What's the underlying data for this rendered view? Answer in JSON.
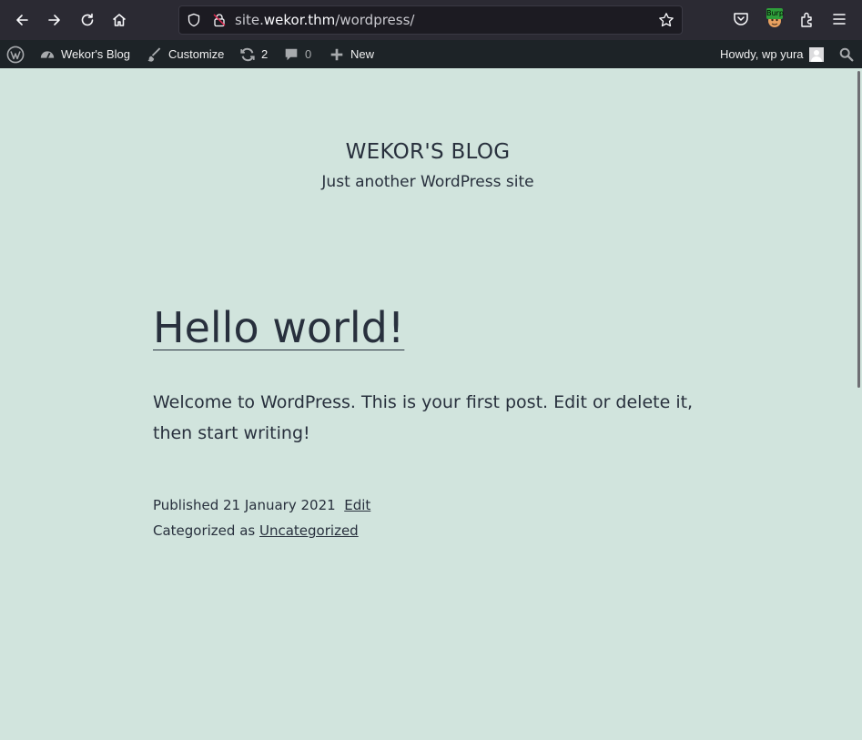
{
  "browser": {
    "url_prefix": "site.",
    "url_host": "wekor.thm",
    "url_path": "/wordpress/",
    "burp_badge": "Burp"
  },
  "adminbar": {
    "site_name": "Wekor's Blog",
    "customize": "Customize",
    "updates_count": "2",
    "comments_count": "0",
    "new_label": "New",
    "howdy": "Howdy, wp yura"
  },
  "site": {
    "title": "WEKOR'S BLOG",
    "description": "Just another WordPress site"
  },
  "post": {
    "title": "Hello world!",
    "body": "Welcome to WordPress. This is your first post. Edit or delete it, then start writing!",
    "published_label": "Published",
    "published_date": "21 January 2021",
    "edit_link": "Edit",
    "categorized_label": "Categorized as",
    "category": "Uncategorized"
  },
  "colors": {
    "page_bg": "#d1e4dd",
    "text": "#28303d",
    "adminbar_bg": "#1d2327",
    "toolbar_bg": "#2b2a33"
  }
}
